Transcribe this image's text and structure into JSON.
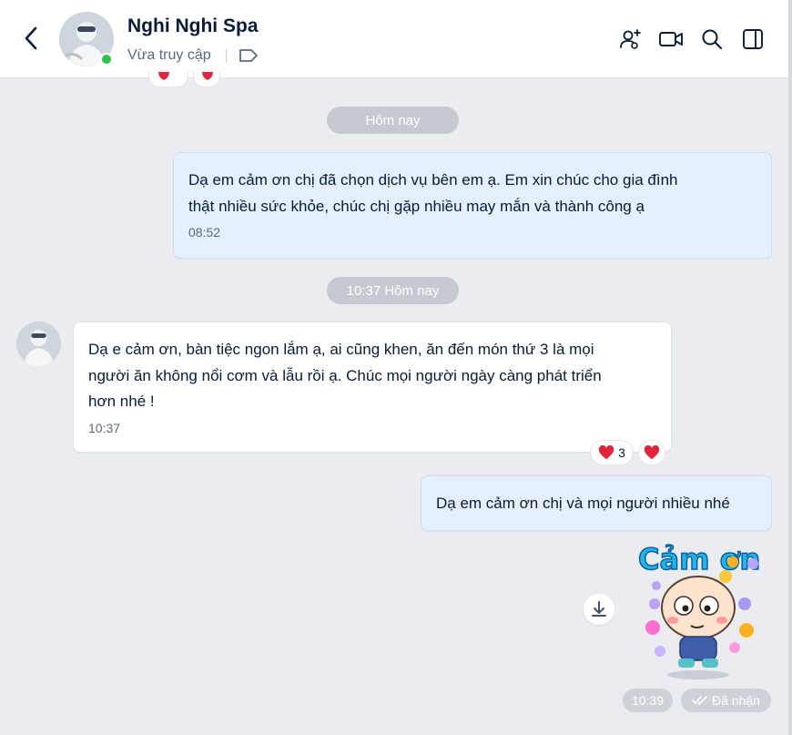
{
  "header": {
    "contact_name": "Nghi Nghi Spa",
    "status": "Vừa truy cập"
  },
  "colors": {
    "online": "#31c048",
    "my_bubble": "#e5efff",
    "their_bubble": "#ffffff",
    "pill": "#c5c9d0",
    "heart": "#e3253c"
  },
  "messages": {
    "date_pill": "Hôm nay",
    "msg1": {
      "line1": "Dạ em cảm ơn chị đã chọn dịch vụ bên em ạ. Em xin chúc cho gia đình",
      "line2": "thật nhiều sức khỏe, chúc chị gặp nhiều may mắn và thành công ạ",
      "time": "08:52"
    },
    "time_pill": "10:37 Hôm nay",
    "msg2": {
      "line1": "Dạ e cảm ơn, bàn tiệc ngon lắm ạ, ai cũng khen, ăn đến món thứ 3 là mọi",
      "line2": "người ăn không nổi cơm và lẫu rồi ạ. Chúc mọi người ngày càng phát triển",
      "line3": "hơn nhé !",
      "time": "10:37",
      "reaction_count": "3"
    },
    "msg3": {
      "text": "Dạ em cảm ơn chị và mọi người nhiều nhé"
    },
    "sticker": {
      "caption": "Cảm ơn",
      "time": "10:39",
      "receipt": "Đã nhận"
    }
  },
  "icons": [
    "back-icon",
    "tag-icon",
    "add-user-icon",
    "video-call-icon",
    "search-icon",
    "sidebar-toggle-icon",
    "heart-icon",
    "download-icon",
    "double-check-icon"
  ]
}
